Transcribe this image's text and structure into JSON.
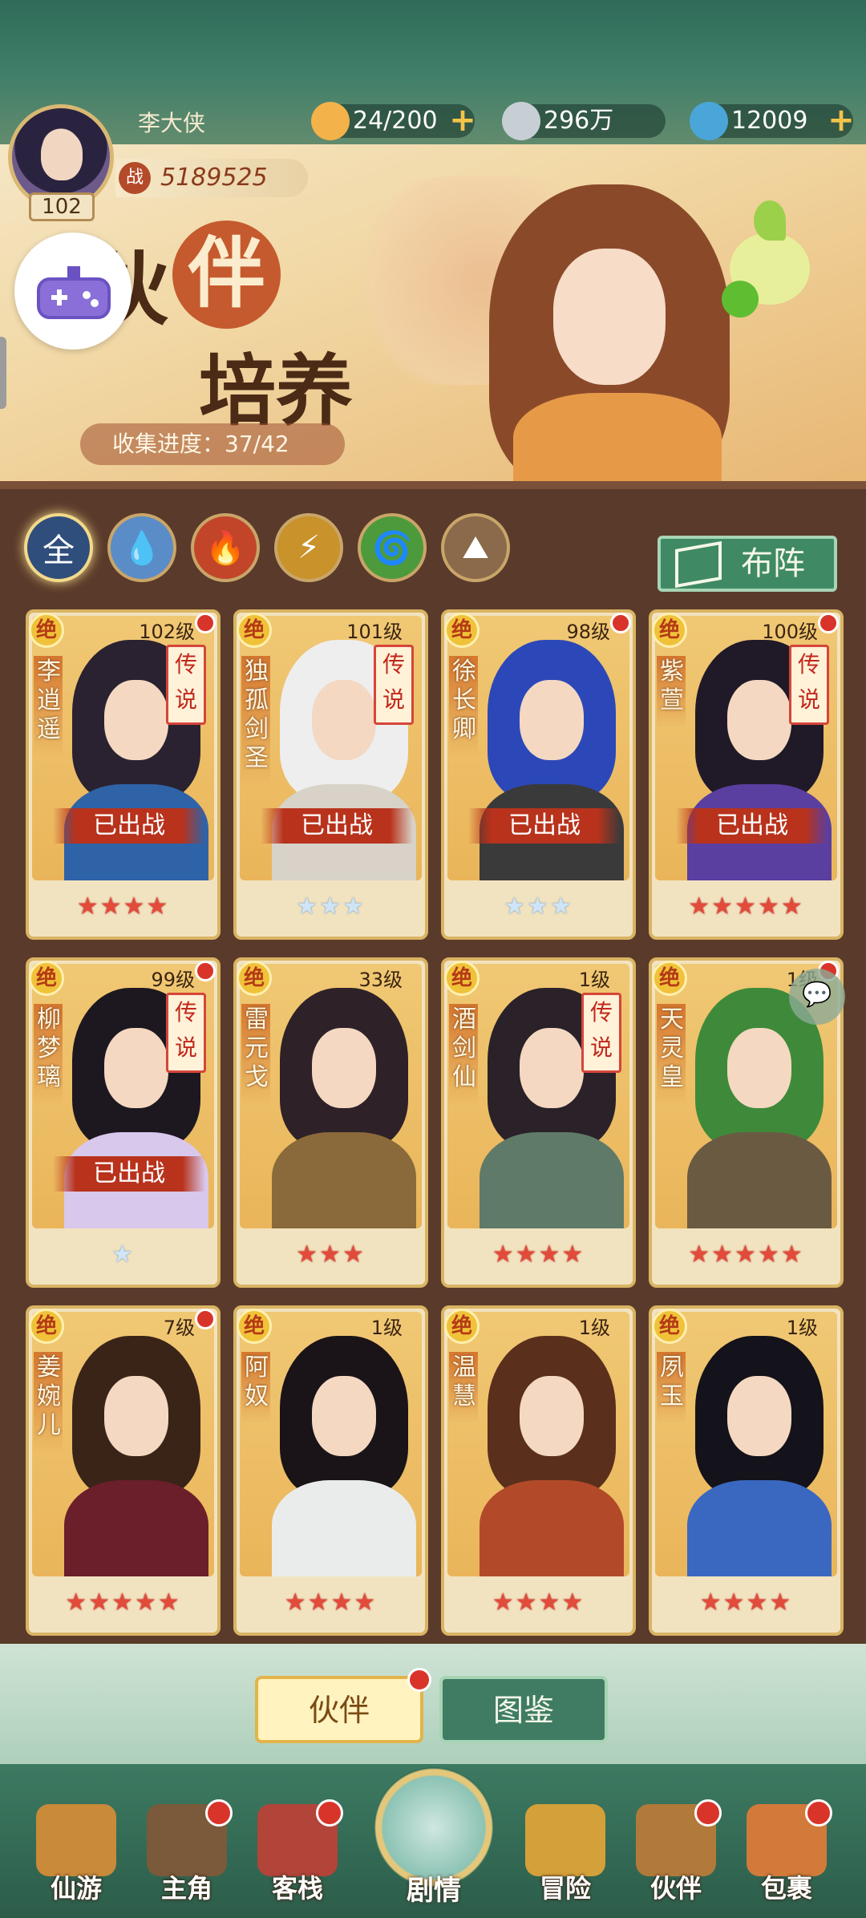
{
  "player": {
    "name": "李大侠",
    "level": "102",
    "power_badge": "战",
    "power": "5189525"
  },
  "resources": [
    {
      "value": "24/200",
      "icon": "bun-icon"
    },
    {
      "value": "296万",
      "icon": "coin-icon"
    },
    {
      "value": "12009",
      "icon": "jade-icon"
    }
  ],
  "banner": {
    "title_char1": "伙",
    "title_char2": "伴",
    "title_line2": "培养",
    "collect_label": "收集进度：",
    "collect_value": "37/42"
  },
  "filters": [
    {
      "label": "全",
      "name": "all",
      "color": "#2f4e7c"
    },
    {
      "label": "💧",
      "name": "water",
      "color": "#5a8cc8"
    },
    {
      "label": "🔥",
      "name": "fire",
      "color": "#c2452a"
    },
    {
      "label": "⚡",
      "name": "thunder",
      "color": "#c9922a"
    },
    {
      "label": "🌀",
      "name": "wind",
      "color": "#4c9a3c"
    },
    {
      "label": "⛰",
      "name": "earth",
      "color": "#8a6a4a"
    }
  ],
  "buzhen_label": "布阵",
  "card_tags": {
    "jue": "绝",
    "legend": "传说",
    "deployed": "已出战"
  },
  "companions": [
    {
      "name": "李逍遥",
      "level": "102级",
      "legend": true,
      "deployed": true,
      "stars": 4,
      "star_type": "red",
      "hair": "#2a2230",
      "robe": "#2f63a8",
      "dot": true
    },
    {
      "name": "独孤剑圣",
      "level": "101级",
      "legend": true,
      "deployed": true,
      "stars": 3,
      "star_type": "blue",
      "hair": "#eeeeee",
      "robe": "#d8d2c8",
      "dot": false
    },
    {
      "name": "徐长卿",
      "level": "98级",
      "legend": false,
      "deployed": true,
      "stars": 3,
      "star_type": "blue",
      "hair": "#2c48b8",
      "robe": "#3a3a3a",
      "dot": true
    },
    {
      "name": "紫萱",
      "level": "100级",
      "legend": true,
      "deployed": true,
      "stars": 5,
      "star_type": "red",
      "hair": "#201a28",
      "robe": "#5a3fa0",
      "dot": true
    },
    {
      "name": "柳梦璃",
      "level": "99级",
      "legend": true,
      "deployed": true,
      "stars": 1,
      "star_type": "blue",
      "hair": "#1d1820",
      "robe": "#d8c8ec",
      "dot": true
    },
    {
      "name": "雷元戈",
      "level": "33级",
      "legend": false,
      "deployed": false,
      "stars": 3,
      "star_type": "red",
      "hair": "#2e2228",
      "robe": "#8a6a3a",
      "dot": false
    },
    {
      "name": "酒剑仙",
      "level": "1级",
      "legend": true,
      "deployed": false,
      "stars": 4,
      "star_type": "red",
      "hair": "#2a2228",
      "robe": "#5f7a68",
      "dot": false
    },
    {
      "name": "天灵皇",
      "level": "1级",
      "legend": false,
      "deployed": false,
      "stars": 5,
      "star_type": "red",
      "hair": "#3f8a3a",
      "robe": "#6a5a42",
      "dot": true
    },
    {
      "name": "姜婉儿",
      "level": "7级",
      "legend": false,
      "deployed": false,
      "stars": 5,
      "star_type": "red",
      "hair": "#3a2418",
      "robe": "#6a1f2a",
      "dot": true
    },
    {
      "name": "阿奴",
      "level": "1级",
      "legend": false,
      "deployed": false,
      "stars": 4,
      "star_type": "red",
      "hair": "#1a1418",
      "robe": "#e9ecea",
      "dot": false
    },
    {
      "name": "温慧",
      "level": "1级",
      "legend": false,
      "deployed": false,
      "stars": 4,
      "star_type": "red",
      "hair": "#5a2f1c",
      "robe": "#b24a2a",
      "dot": false
    },
    {
      "name": "夙玉",
      "level": "1级",
      "legend": false,
      "deployed": false,
      "stars": 4,
      "star_type": "red",
      "hair": "#14121a",
      "robe": "#3a68c0",
      "dot": false
    }
  ],
  "subtabs": {
    "companion": "伙伴",
    "gallery": "图鉴"
  },
  "nav": [
    {
      "label": "仙游",
      "dot": false,
      "color": "#c98a3a"
    },
    {
      "label": "主角",
      "dot": true,
      "color": "#7a5a3a"
    },
    {
      "label": "客栈",
      "dot": true,
      "color": "#b2443a"
    },
    {
      "label": "冒险",
      "dot": false,
      "color": "#d4a03a"
    },
    {
      "label": "伙伴",
      "dot": true,
      "color": "#b27a3a"
    },
    {
      "label": "包裹",
      "dot": true,
      "color": "#d27a3a"
    }
  ],
  "nav_center": {
    "label": "剧情"
  }
}
